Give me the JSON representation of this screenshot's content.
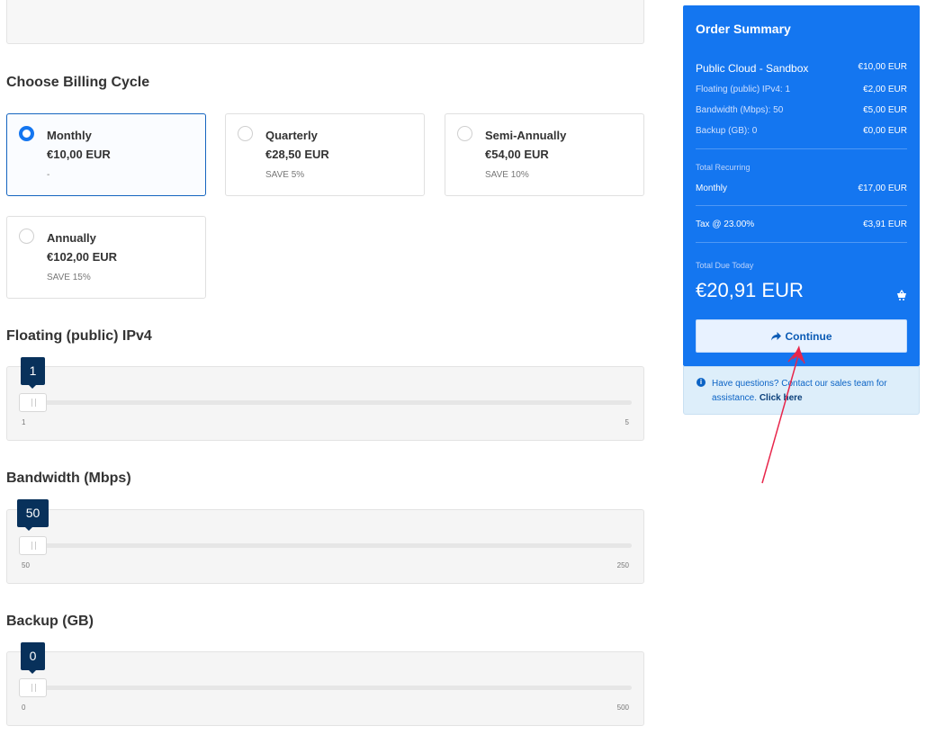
{
  "billing": {
    "title": "Choose Billing Cycle",
    "cycles": [
      {
        "name": "Monthly",
        "price": "€10,00 EUR",
        "save": "-",
        "selected": true
      },
      {
        "name": "Quarterly",
        "price": "€28,50 EUR",
        "save": "SAVE 5%",
        "selected": false
      },
      {
        "name": "Semi-Annually",
        "price": "€54,00 EUR",
        "save": "SAVE 10%",
        "selected": false
      },
      {
        "name": "Annually",
        "price": "€102,00 EUR",
        "save": "SAVE 15%",
        "selected": false
      }
    ]
  },
  "options": {
    "ipv4": {
      "title": "Floating (public) IPv4",
      "value": "1",
      "min": "1",
      "max": "5"
    },
    "bandwidth": {
      "title": "Bandwidth (Mbps)",
      "value": "50",
      "min": "50",
      "max": "250"
    },
    "backup": {
      "title": "Backup (GB)",
      "value": "0",
      "min": "0",
      "max": "500"
    }
  },
  "summary": {
    "title": "Order Summary",
    "product": {
      "label": "Public Cloud - Sandbox",
      "value": "€10,00 EUR"
    },
    "lines": [
      {
        "label": "Floating (public) IPv4: 1",
        "value": "€2,00 EUR"
      },
      {
        "label": "Bandwidth (Mbps): 50",
        "value": "€5,00 EUR"
      },
      {
        "label": "Backup (GB): 0",
        "value": "€0,00 EUR"
      }
    ],
    "recurring_label": "Total Recurring",
    "recurring": {
      "label": "Monthly",
      "value": "€17,00 EUR"
    },
    "tax": {
      "label": "Tax @ 23.00%",
      "value": "€3,91 EUR"
    },
    "due_label": "Total Due Today",
    "due_amount": "€20,91 EUR",
    "continue_label": "Continue"
  },
  "help": {
    "text": "Have questions? Contact our sales team for assistance.",
    "link": "Click here"
  },
  "colors": {
    "accent": "#1476f0",
    "tooltip": "#08315b",
    "annotation": "#e8264b"
  },
  "icons": {
    "continue": "share-arrow-icon",
    "cart": "cart-icon",
    "info": "info-circle-icon"
  }
}
